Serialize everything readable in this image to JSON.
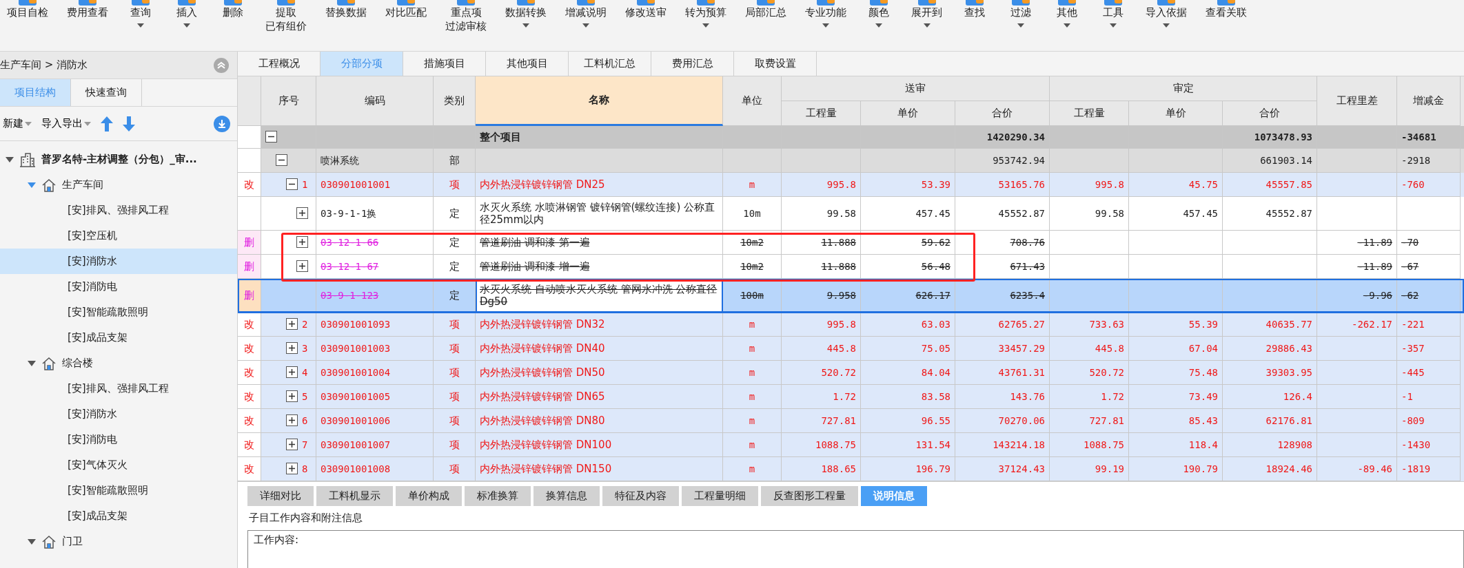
{
  "toolbar": [
    {
      "label": "项目自检",
      "dropdown": false
    },
    {
      "label": "费用查看",
      "dropdown": false
    },
    {
      "label": "查询",
      "dropdown": true
    },
    {
      "label": "插入",
      "dropdown": true
    },
    {
      "label": "删除",
      "dropdown": false
    },
    {
      "label": "提取",
      "sublabel": "已有组价",
      "dropdown": false
    },
    {
      "label": "替换数据",
      "dropdown": false
    },
    {
      "label": "对比匹配",
      "dropdown": false
    },
    {
      "label": "重点项",
      "sublabel": "过滤审核",
      "dropdown": false
    },
    {
      "label": "数据转换",
      "dropdown": true
    },
    {
      "label": "增减说明",
      "dropdown": true
    },
    {
      "label": "修改送审",
      "dropdown": false
    },
    {
      "label": "转为预算",
      "dropdown": true
    },
    {
      "label": "局部汇总",
      "dropdown": false
    },
    {
      "label": "专业功能",
      "dropdown": true
    },
    {
      "label": "颜色",
      "dropdown": true
    },
    {
      "label": "展开到",
      "dropdown": true
    },
    {
      "label": "查找",
      "dropdown": false
    },
    {
      "label": "过滤",
      "dropdown": true
    },
    {
      "label": "其他",
      "dropdown": true
    },
    {
      "label": "工具",
      "dropdown": true
    },
    {
      "label": "导入依据",
      "dropdown": true
    },
    {
      "label": "查看关联",
      "dropdown": false
    }
  ],
  "sidebar": {
    "breadcrumb": "生产车间 > 消防水",
    "tabs": [
      {
        "label": "项目结构",
        "selected": true
      },
      {
        "label": "快速查询",
        "selected": false
      }
    ],
    "actions": [
      {
        "label": "新建",
        "dropdown": true
      },
      {
        "label": "导入导出",
        "dropdown": true
      }
    ],
    "tree": [
      {
        "kind": "project",
        "label": "普罗名特-主材调整（分包）_审...",
        "expanded": true,
        "children": [
          {
            "kind": "building",
            "label": "生产车间",
            "expanded": true,
            "children": [
              {
                "label": "[安]排风、强排风工程",
                "selected": false
              },
              {
                "label": "[安]空压机",
                "selected": false
              },
              {
                "label": "[安]消防水",
                "selected": true
              },
              {
                "label": "[安]消防电",
                "selected": false
              },
              {
                "label": "[安]智能疏散照明",
                "selected": false
              },
              {
                "label": "[安]成品支架",
                "selected": false
              }
            ]
          },
          {
            "kind": "building",
            "label": "综合楼",
            "expanded": true,
            "children": [
              {
                "label": "[安]排风、强排风工程",
                "selected": false
              },
              {
                "label": "[安]消防水",
                "selected": false
              },
              {
                "label": "[安]消防电",
                "selected": false
              },
              {
                "label": "[安]气体灭火",
                "selected": false
              },
              {
                "label": "[安]智能疏散照明",
                "selected": false
              },
              {
                "label": "[安]成品支架",
                "selected": false
              }
            ]
          },
          {
            "kind": "building",
            "label": "门卫",
            "expanded": true
          }
        ]
      }
    ]
  },
  "tabs": [
    {
      "label": "工程概况",
      "selected": false
    },
    {
      "label": "分部分项",
      "selected": true
    },
    {
      "label": "措施项目",
      "selected": false
    },
    {
      "label": "其他项目",
      "selected": false
    },
    {
      "label": "工料机汇总",
      "selected": false
    },
    {
      "label": "费用汇总",
      "selected": false
    },
    {
      "label": "取费设置",
      "selected": false
    }
  ],
  "table": {
    "columns": [
      {
        "kind": "single",
        "label": "序号",
        "selected": false
      },
      {
        "kind": "single",
        "label": "编码",
        "selected": false
      },
      {
        "kind": "single",
        "label": "类别",
        "selected": false
      },
      {
        "kind": "single",
        "label": "名称",
        "selected": true
      },
      {
        "kind": "single",
        "label": "单位",
        "selected": false
      },
      {
        "kind": "group",
        "label": "送审",
        "selected": false,
        "children": [
          "工程量",
          "单价",
          "合价"
        ]
      },
      {
        "kind": "group",
        "label": "审定",
        "selected": false,
        "children": [
          "工程量",
          "单价",
          "合价"
        ]
      },
      {
        "kind": "single",
        "label": "工程里差",
        "selected": false
      },
      {
        "kind": "single",
        "label": "增减金",
        "selected": false
      }
    ],
    "rows": [
      {
        "kind": "total",
        "name": "整个项目",
        "sent_total": "1420290.34",
        "approved_total": "1073478.93",
        "change": "-34681",
        "expanded": true,
        "deleted": false,
        "selected": false,
        "boxed": false,
        "children": [
          {
            "kind": "section",
            "code": "喷淋系统",
            "type": "部",
            "sent_total": "953742.94",
            "approved_total": "661903.14",
            "change": "-2918",
            "expanded": true,
            "deleted": false,
            "selected": false,
            "boxed": false,
            "children": [
              {
                "kind": "item",
                "mark": "改",
                "seq": "1",
                "code": "030901001001",
                "type": "项",
                "name": "内外热浸锌镀锌钢管 DN25",
                "unit": "m",
                "sent_qty": "995.8",
                "sent_price": "53.39",
                "sent_total": "53165.76",
                "approved_qty": "995.8",
                "approved_price": "45.75",
                "approved_total": "45557.85",
                "change": "-760",
                "expanded": true,
                "deleted": false,
                "selected": false,
                "boxed": false,
                "children": [
                  {
                    "kind": "quota",
                    "code": "03-9-1-1换",
                    "type": "定",
                    "name": "水灭火系统 水喷淋钢管 镀锌钢管(螺纹连接) 公称直径25mm以内",
                    "unit": "10m",
                    "sent_qty": "99.58",
                    "sent_price": "457.45",
                    "sent_total": "45552.87",
                    "approved_qty": "99.58",
                    "approved_price": "457.45",
                    "approved_total": "45552.87",
                    "expanded": false,
                    "deleted": false,
                    "selected": false,
                    "boxed": false
                  },
                  {
                    "kind": "quota",
                    "mark": "删",
                    "code": "03-12-1-66",
                    "type": "定",
                    "name": "管道刷油 调和漆 第一遍",
                    "unit": "10m2",
                    "sent_qty": "11.888",
                    "sent_price": "59.62",
                    "sent_total": "708.76",
                    "qty_diff": "-11.89",
                    "change": "-70",
                    "expanded": false,
                    "deleted": true,
                    "selected": false,
                    "boxed": true
                  },
                  {
                    "kind": "quota",
                    "mark": "删",
                    "code": "03-12-1-67",
                    "type": "定",
                    "name": "管道刷油 调和漆 增一遍",
                    "unit": "10m2",
                    "sent_qty": "11.888",
                    "sent_price": "56.48",
                    "sent_total": "671.43",
                    "qty_diff": "-11.89",
                    "change": "-67",
                    "expanded": false,
                    "deleted": true,
                    "selected": false,
                    "boxed": true
                  },
                  {
                    "kind": "quota",
                    "mark": "删",
                    "code": "03-9-1-123",
                    "type": "定",
                    "name": "水灭火系统 自动喷水灭火系统 管网水冲洗 公称直径Dg50",
                    "unit": "100m",
                    "sent_qty": "9.958",
                    "sent_price": "626.17",
                    "sent_total": "6235.4",
                    "qty_diff": "-9.96",
                    "change": "-62",
                    "deleted": true,
                    "selected": true,
                    "boxed": false
                  }
                ]
              },
              {
                "kind": "item",
                "mark": "改",
                "seq": "2",
                "code": "030901001093",
                "type": "项",
                "name": "内外热浸锌镀锌钢管 DN32",
                "unit": "m",
                "sent_qty": "995.8",
                "sent_price": "63.03",
                "sent_total": "62765.27",
                "approved_qty": "733.63",
                "approved_price": "55.39",
                "approved_total": "40635.77",
                "qty_diff": "-262.17",
                "change": "-221",
                "expanded": false,
                "deleted": false,
                "selected": false,
                "boxed": false
              },
              {
                "kind": "item",
                "mark": "改",
                "seq": "3",
                "code": "030901001003",
                "type": "项",
                "name": "内外热浸锌镀锌钢管 DN40",
                "unit": "m",
                "sent_qty": "445.8",
                "sent_price": "75.05",
                "sent_total": "33457.29",
                "approved_qty": "445.8",
                "approved_price": "67.04",
                "approved_total": "29886.43",
                "change": "-357",
                "expanded": false,
                "deleted": false,
                "selected": false,
                "boxed": false
              },
              {
                "kind": "item",
                "mark": "改",
                "seq": "4",
                "code": "030901001004",
                "type": "项",
                "name": "内外热浸锌镀锌钢管 DN50",
                "unit": "m",
                "sent_qty": "520.72",
                "sent_price": "84.04",
                "sent_total": "43761.31",
                "approved_qty": "520.72",
                "approved_price": "75.48",
                "approved_total": "39303.95",
                "change": "-445",
                "expanded": false,
                "deleted": false,
                "selected": false,
                "boxed": false
              },
              {
                "kind": "item",
                "mark": "改",
                "seq": "5",
                "code": "030901001005",
                "type": "项",
                "name": "内外热浸锌镀锌钢管 DN65",
                "unit": "m",
                "sent_qty": "1.72",
                "sent_price": "83.58",
                "sent_total": "143.76",
                "approved_qty": "1.72",
                "approved_price": "73.49",
                "approved_total": "126.4",
                "change": "-1",
                "expanded": false,
                "deleted": false,
                "selected": false,
                "boxed": false
              },
              {
                "kind": "item",
                "mark": "改",
                "seq": "6",
                "code": "030901001006",
                "type": "项",
                "name": "内外热浸锌镀锌钢管 DN80",
                "unit": "m",
                "sent_qty": "727.81",
                "sent_price": "96.55",
                "sent_total": "70270.06",
                "approved_qty": "727.81",
                "approved_price": "85.43",
                "approved_total": "62176.81",
                "change": "-809",
                "expanded": false,
                "deleted": false,
                "selected": false,
                "boxed": false
              },
              {
                "kind": "item",
                "mark": "改",
                "seq": "7",
                "code": "030901001007",
                "type": "项",
                "name": "内外热浸锌镀锌钢管 DN100",
                "unit": "m",
                "sent_qty": "1088.75",
                "sent_price": "131.54",
                "sent_total": "143214.18",
                "approved_qty": "1088.75",
                "approved_price": "118.4",
                "approved_total": "128908",
                "change": "-1430",
                "expanded": false,
                "deleted": false,
                "selected": false,
                "boxed": false
              },
              {
                "kind": "item",
                "mark": "改",
                "seq": "8",
                "code": "030901001008",
                "type": "项",
                "name": "内外热浸锌镀锌钢管 DN150",
                "unit": "m",
                "sent_qty": "188.65",
                "sent_price": "196.79",
                "sent_total": "37124.43",
                "approved_qty": "99.19",
                "approved_price": "190.79",
                "approved_total": "18924.46",
                "qty_diff": "-89.46",
                "change": "-1819",
                "expanded": false,
                "deleted": false,
                "selected": false,
                "boxed": false
              }
            ]
          }
        ]
      }
    ]
  },
  "detail_tabs": [
    {
      "label": "详细对比",
      "selected": false
    },
    {
      "label": "工料机显示",
      "selected": false
    },
    {
      "label": "单价构成",
      "selected": false
    },
    {
      "label": "标准换算",
      "selected": false
    },
    {
      "label": "换算信息",
      "selected": false
    },
    {
      "label": "特征及内容",
      "selected": false
    },
    {
      "label": "工程量明细",
      "selected": false
    },
    {
      "label": "反查图形工程量",
      "selected": false
    },
    {
      "label": "说明信息",
      "selected": true
    }
  ],
  "detail": {
    "title": "子目工作内容和附注信息",
    "text": "工作内容:"
  }
}
